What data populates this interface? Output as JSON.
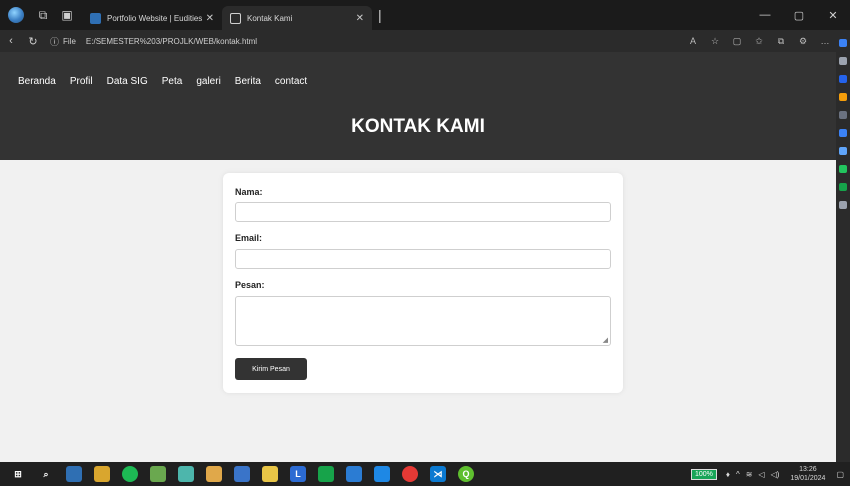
{
  "browser": {
    "tabs": [
      {
        "label": "Portfolio Website | Eudities",
        "active": false
      },
      {
        "label": "Kontak Kami",
        "active": true
      }
    ],
    "address": {
      "scheme": "File",
      "path": "E:/SEMESTER%203/PROJLK/WEB/kontak.html"
    }
  },
  "site": {
    "nav": [
      "Beranda",
      "Profil",
      "Data SIG",
      "Peta",
      "galeri",
      "Berita",
      "contact"
    ],
    "title": "KONTAK KAMI"
  },
  "form": {
    "name_label": "Nama:",
    "email_label": "Email:",
    "message_label": "Pesan:",
    "submit_label": "Kirim Pesan"
  },
  "taskbar": {
    "battery": "100%",
    "time": "13:26",
    "date": "19/01/2024"
  },
  "colors": {
    "header_bg": "#333333",
    "page_bg": "#f1f1f1",
    "button_bg": "#333333",
    "battery_green": "#18a558"
  }
}
